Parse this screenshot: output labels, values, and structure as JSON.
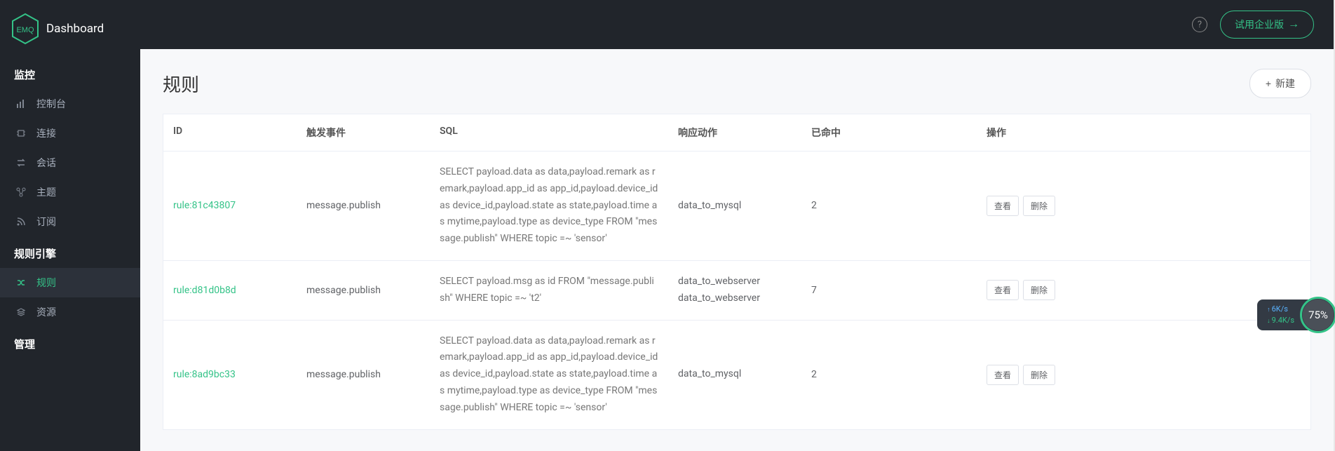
{
  "header": {
    "logo_text": "EMQ",
    "dashboard_label": "Dashboard",
    "trial_button": "试用企业版"
  },
  "sidebar": {
    "sections": [
      {
        "title": "监控",
        "items": [
          {
            "icon": "bars",
            "label": "控制台"
          },
          {
            "icon": "chip",
            "label": "连接"
          },
          {
            "icon": "swap",
            "label": "会话"
          },
          {
            "icon": "node",
            "label": "主题"
          },
          {
            "icon": "rss",
            "label": "订阅"
          }
        ]
      },
      {
        "title": "规则引擎",
        "items": [
          {
            "icon": "shuffle",
            "label": "规则",
            "active": true
          },
          {
            "icon": "layers",
            "label": "资源"
          }
        ]
      },
      {
        "title": "管理",
        "items": []
      }
    ]
  },
  "page": {
    "title": "规则",
    "new_button": "新建"
  },
  "table": {
    "headers": {
      "id": "ID",
      "trigger": "触发事件",
      "sql": "SQL",
      "response_actions": "响应动作",
      "matched": "已命中",
      "operations": "操作"
    },
    "rows": [
      {
        "id": "rule:81c43807",
        "trigger": "message.publish",
        "sql": "SELECT payload.data as data,payload.remark as remark,payload.app_id as app_id,payload.device_id as device_id,payload.state as state,payload.time as mytime,payload.type as device_type FROM \"message.publish\" WHERE topic =~ 'sensor'",
        "actions": [
          "data_to_mysql"
        ],
        "matched": "2"
      },
      {
        "id": "rule:d81d0b8d",
        "trigger": "message.publish",
        "sql": "SELECT payload.msg as id FROM \"message.publish\" WHERE topic =~ 't2'",
        "actions": [
          "data_to_webserver",
          "data_to_webserver"
        ],
        "matched": "7"
      },
      {
        "id": "rule:8ad9bc33",
        "trigger": "message.publish",
        "sql": "SELECT payload.data as data,payload.remark as remark,payload.app_id as app_id,payload.device_id as device_id,payload.state as state,payload.time as mytime,payload.type as device_type FROM \"message.publish\" WHERE topic =~ 'sensor'",
        "actions": [
          "data_to_mysql"
        ],
        "matched": "2"
      }
    ],
    "op_view": "查看",
    "op_delete": "删除"
  },
  "perf": {
    "up_rate": "6K/s",
    "down_rate": "9.4K/s",
    "percent": "75%"
  }
}
